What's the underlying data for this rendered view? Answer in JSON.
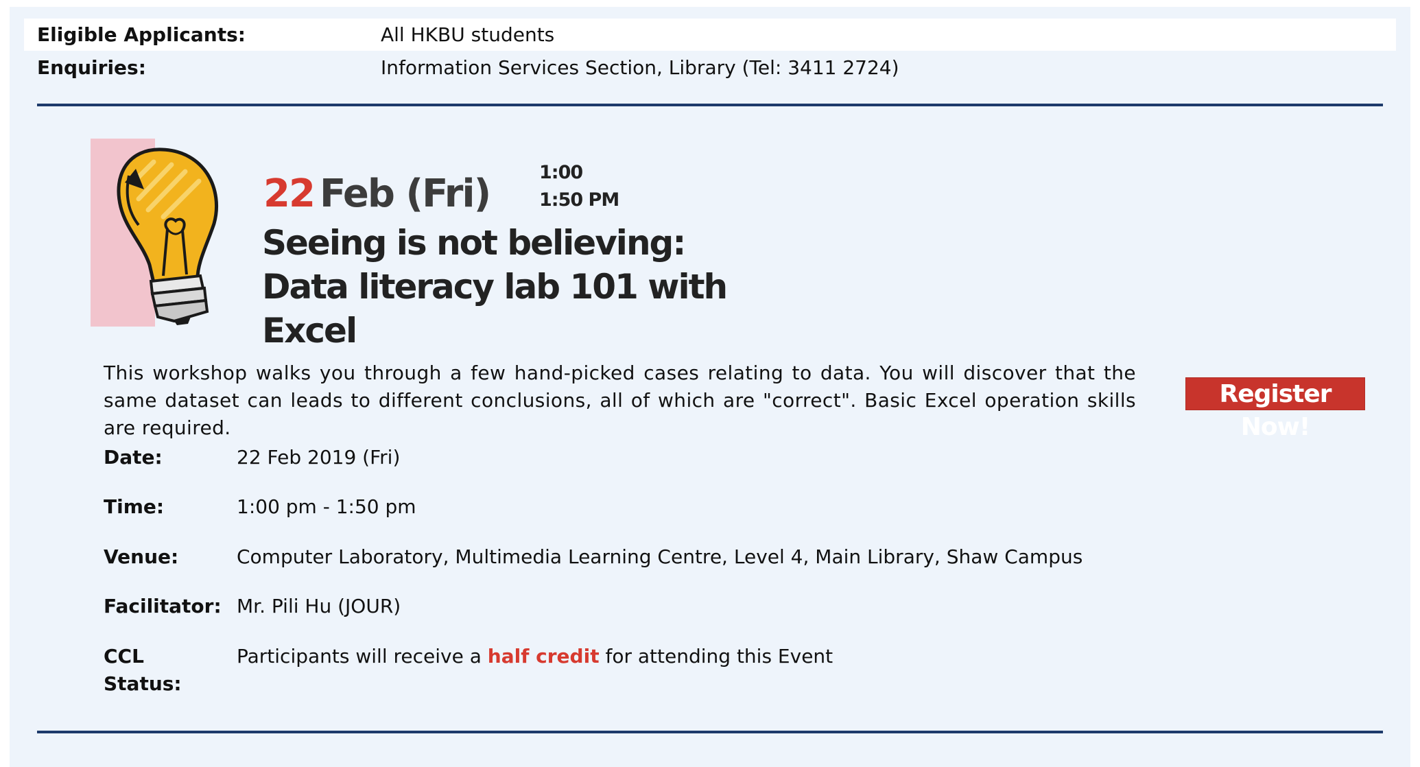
{
  "header": {
    "eligible_label": "Eligible Applicants:",
    "eligible_value": "All HKBU students",
    "enquiries_label": "Enquiries:",
    "enquiries_value": "Information Services Section, Library (Tel: 3411 2724)"
  },
  "banner": {
    "date_day": "22",
    "date_rest": "Feb (Fri)",
    "time_start": "1:00",
    "time_end": "1:50 PM",
    "title_line1": "Seeing is not believing:",
    "title_line2": "Data literacy lab 101 with Excel",
    "icon": "lightbulb-icon"
  },
  "event": {
    "description": "This workshop walks you through a few hand-picked cases relating to data. You will discover that the same dataset can leads to different conclusions, all of which are \"correct\". Basic Excel operation skills are required.",
    "register_label": "Register Now!",
    "date_label": "Date:",
    "date_value": "22 Feb 2019 (Fri)",
    "time_label": "Time:",
    "time_value": "1:00 pm - 1:50 pm",
    "venue_label": "Venue:",
    "venue_value": "Computer Laboratory, Multimedia Learning Centre, Level 4, Main Library, Shaw Campus",
    "facilitator_label": "Facilitator:",
    "facilitator_value": "Mr. Pili Hu (JOUR)",
    "ccl_label_line1": "CCL",
    "ccl_label_line2": "Status:",
    "ccl_prefix": "Participants will receive a ",
    "ccl_highlight": "half credit",
    "ccl_suffix": " for attending this Event"
  },
  "colors": {
    "background": "#eef4fb",
    "divider": "#1d3a6b",
    "accent_red": "#d73a2f",
    "register_bg": "#c8342c",
    "banner_pink": "#f2c4cd"
  }
}
